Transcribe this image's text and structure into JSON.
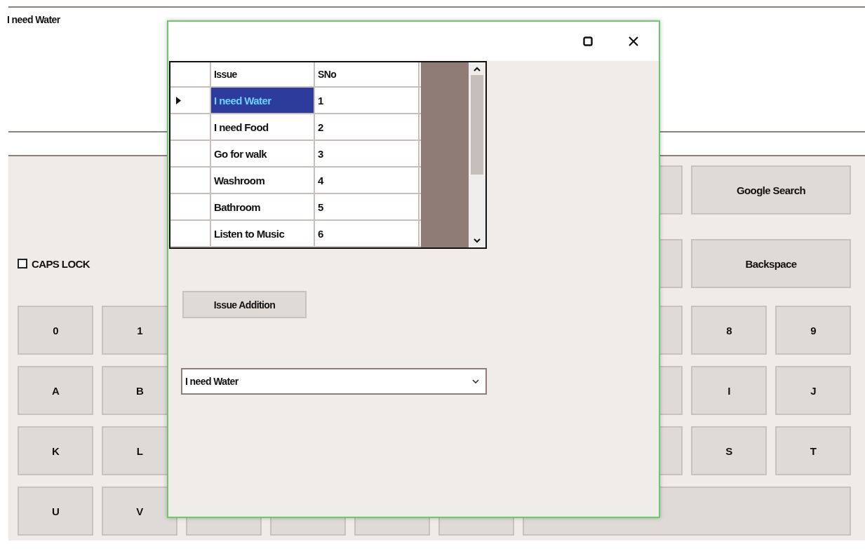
{
  "main_form": {
    "text_area": {
      "value": "I need Water"
    },
    "caps_lock": {
      "label": "CAPS LOCK",
      "checked": false
    },
    "keyboard_rows": [
      [
        {
          "kind": "covered"
        },
        {
          "kind": "wide",
          "label": "Google Search"
        }
      ],
      [
        {
          "kind": "caps"
        },
        {
          "kind": "covered"
        },
        {
          "kind": "wide",
          "label": "Backspace"
        }
      ],
      [
        {
          "kind": "key",
          "label": "0"
        },
        {
          "kind": "key",
          "label": "1"
        },
        {
          "kind": "covered"
        },
        {
          "kind": "key",
          "label": "8"
        },
        {
          "kind": "key",
          "label": "9"
        }
      ],
      [
        {
          "kind": "key",
          "label": "A"
        },
        {
          "kind": "key",
          "label": "B"
        },
        {
          "kind": "covered"
        },
        {
          "kind": "key",
          "label": "I"
        },
        {
          "kind": "key",
          "label": "J"
        }
      ],
      [
        {
          "kind": "key",
          "label": "K"
        },
        {
          "kind": "key",
          "label": "L"
        },
        {
          "kind": "covered"
        },
        {
          "kind": "key",
          "label": "S"
        },
        {
          "kind": "key",
          "label": "T"
        }
      ],
      [
        {
          "kind": "key",
          "label": "U"
        },
        {
          "kind": "key",
          "label": "V"
        },
        {
          "kind": "covered"
        },
        {
          "kind": "covered"
        },
        {
          "kind": "covered"
        },
        {
          "kind": "covered"
        },
        {
          "kind": "space"
        }
      ]
    ]
  },
  "dialog": {
    "grid": {
      "columns": [
        "Issue",
        "SNo"
      ],
      "rows": [
        {
          "issue": "I need Water",
          "sno": "1",
          "selected": true
        },
        {
          "issue": "I need Food",
          "sno": "2",
          "selected": false
        },
        {
          "issue": "Go for walk",
          "sno": "3",
          "selected": false
        },
        {
          "issue": "Washroom",
          "sno": "4",
          "selected": false
        },
        {
          "issue": "Bathroom",
          "sno": "5",
          "selected": false
        },
        {
          "issue": "Listen to Music",
          "sno": "6",
          "selected": false
        }
      ]
    },
    "add_button": {
      "label": "Issue Addition"
    },
    "combo": {
      "value": "I need Water"
    }
  }
}
